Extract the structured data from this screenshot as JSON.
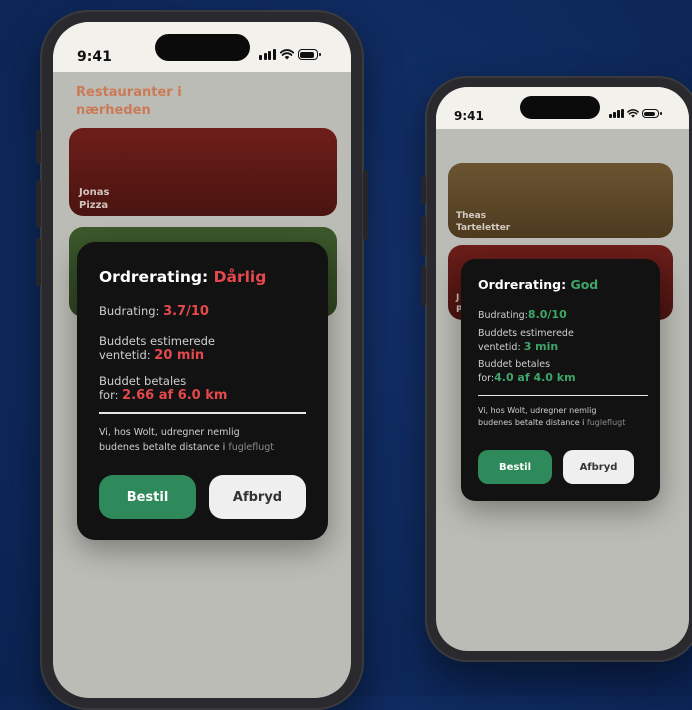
{
  "colors": {
    "background": "#0e2a5e",
    "bad": "#e5484d",
    "good": "#3fa66a",
    "order_button": "#2e8a5a"
  },
  "left_phone": {
    "status": {
      "time": "9:41",
      "icons": [
        "signal-icon",
        "wifi-icon",
        "battery-icon"
      ]
    },
    "section_title": {
      "line1": "Restauranter i",
      "line2": "nærheden"
    },
    "cards": [
      {
        "line1": "Jonas",
        "line2": "Pizza"
      }
    ],
    "dialog": {
      "title_prefix": "Ordrerating: ",
      "rating": "Dårlig",
      "courier_rating_label": "Budrating: ",
      "courier_rating_value": "3.7/10",
      "wait_label_line1": "Buddets estimerede",
      "wait_label_line2": "ventetid: ",
      "wait_value": "20 min",
      "pay_label_line1": "Buddet betales",
      "pay_label_line2": "for: ",
      "pay_value": "2.66 af 6.0 km",
      "note_line1": "Vi, hos Wolt, udregner nemlig",
      "note_line2": "budenes betalte distance i ",
      "note_highlight": "fugleflugt",
      "order_button": "Bestil",
      "cancel_button": "Afbryd"
    }
  },
  "right_phone": {
    "status": {
      "time": "9:41",
      "icons": [
        "signal-icon",
        "wifi-icon",
        "battery-icon"
      ]
    },
    "cards": [
      {
        "line1": "Theas",
        "line2": "Tarteletter"
      },
      {
        "line1": "J",
        "line2": "P"
      }
    ],
    "dialog": {
      "title_prefix": "Ordrerating: ",
      "rating": "God",
      "courier_rating_label": "Budrating:",
      "courier_rating_value": "8.0/10",
      "wait_label_line1": "Buddets estimerede",
      "wait_label_line2": "ventetid: ",
      "wait_value": "3 min",
      "pay_label_line1": "Buddet betales",
      "pay_label_line2": "for:",
      "pay_value": "4.0 af 4.0 km",
      "note_line1": "Vi, hos Wolt, udregner nemlig",
      "note_line2": "budenes betalte distance i ",
      "note_highlight": "fugleflugt",
      "order_button": "Bestil",
      "cancel_button": "Afbryd"
    }
  }
}
